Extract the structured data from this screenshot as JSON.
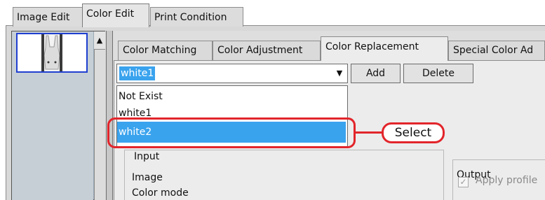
{
  "top_tabs": [
    "Image Edit",
    "Color Edit",
    "Print Condition"
  ],
  "sub_tabs": [
    "Color Matching",
    "Color Adjustment",
    "Color Replacement",
    "Special Color Ad"
  ],
  "combo": {
    "value": "white1"
  },
  "buttons": {
    "add": "Add",
    "delete": "Delete"
  },
  "dropdown_options": [
    "Not Exist",
    "white1",
    "white2"
  ],
  "callout": "Select",
  "input_group": {
    "title": "Input",
    "image": "Image",
    "color_mode": "Color mode"
  },
  "output_group": {
    "title": "Output",
    "apply_profile": "Apply profile",
    "checkbox_mark": "✓"
  },
  "icons": {
    "scroll_up": "▲",
    "dropdown_arrow": "▼"
  },
  "colors": {
    "selection": "#3aa3ee",
    "annotation_red": "#e2252b",
    "thumb_border": "#1f3fd0"
  }
}
